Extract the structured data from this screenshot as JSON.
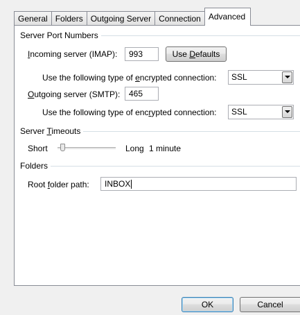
{
  "tabs": [
    "General",
    "Folders",
    "Outgoing Server",
    "Connection",
    "Advanced"
  ],
  "active_tab": "Advanced",
  "server_ports": {
    "group_label": "Server Port Numbers",
    "incoming_label_pre": "",
    "incoming_label_u": "I",
    "incoming_label_post": "ncoming server (IMAP):",
    "incoming_value": "993",
    "use_defaults_pre": "Use ",
    "use_defaults_u": "D",
    "use_defaults_post": "efaults",
    "enc_in_label_pre": "Use the following type of ",
    "enc_in_label_u": "e",
    "enc_in_label_post": "ncrypted connection:",
    "enc_in_value": "SSL",
    "outgoing_label_u": "O",
    "outgoing_label_post": "utgoing server (SMTP):",
    "outgoing_value": "465",
    "enc_out_label_pre": "Use the following type of enc",
    "enc_out_label_u": "r",
    "enc_out_label_post": "ypted connection:",
    "enc_out_value": "SSL"
  },
  "timeouts": {
    "group_label_pre": "Server ",
    "group_label_u": "T",
    "group_label_post": "imeouts",
    "short_label": "Short",
    "long_label": "Long",
    "value": "1 minute",
    "level": 0.05
  },
  "folders": {
    "group_label": "Folders",
    "root_label_pre": "Root ",
    "root_label_u": "f",
    "root_label_post": "older path:",
    "root_value": "INBOX"
  },
  "buttons": {
    "ok": "OK",
    "cancel": "Cancel"
  },
  "colors": {
    "panel_bg": "#ffffff",
    "dialog_bg": "#f0f0f0",
    "ok_border": "#3c7fb1"
  }
}
